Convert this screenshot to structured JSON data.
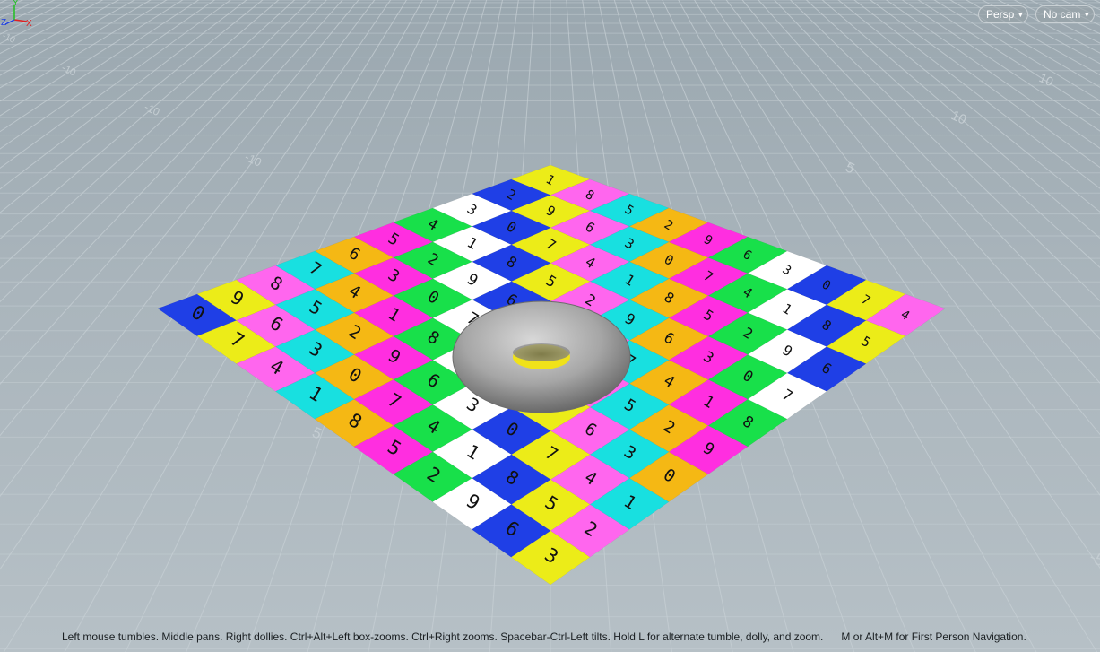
{
  "viewport": {
    "camera_mode": "Persp",
    "camera": "No cam",
    "status_hint": "Left mouse tumbles. Middle pans. Right dollies. Ctrl+Alt+Left box-zooms. Ctrl+Right zooms. Spacebar-Ctrl-Left tilts. Hold L for alternate tumble, dolly, and zoom.      M or Alt+M for First Person Navigation.",
    "grid_labels": [
      "-10",
      "-10",
      "-10",
      "-10",
      "10",
      "10",
      "5",
      "5",
      "-5"
    ],
    "axis_labels": {
      "x": "X",
      "y": "Y",
      "z": "Z"
    }
  },
  "checker": {
    "colors": {
      "1": "#ffffff",
      "2": "#f5b814",
      "3": "#ecec18",
      "4": "#18e04a",
      "5": "#18e0e0",
      "6": "#1f3fe6",
      "7": "#ff2ee0",
      "8": "#ff66ee"
    },
    "digits": [
      "1",
      "2",
      "3",
      "4",
      "5",
      "6",
      "7",
      "8",
      "9",
      "0"
    ]
  },
  "object": {
    "name": "torus",
    "color": "#9a9a9a"
  },
  "icons": {
    "persp_caret": "chevron-down-icon",
    "cam_caret": "chevron-down-icon",
    "gizmo": "axis-gizmo-icon"
  }
}
